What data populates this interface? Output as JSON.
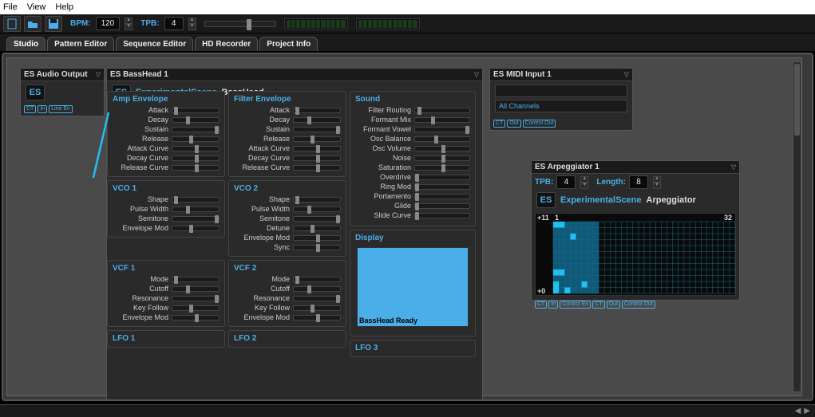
{
  "menu": {
    "file": "File",
    "view": "View",
    "help": "Help"
  },
  "toolbar": {
    "bpm_label": "BPM:",
    "bpm_value": "120",
    "tpb_label": "TPB:",
    "tpb_value": "4"
  },
  "tabs": {
    "studio": "Studio",
    "pattern": "Pattern Editor",
    "sequence": "Sequence Editor",
    "hd": "HD Recorder",
    "project": "Project Info"
  },
  "audio_out": {
    "title": "ES Audio Output",
    "port_ct": "CT",
    "port_in": "In",
    "port_line": "Line En"
  },
  "basshead": {
    "title": "ES BassHead 1",
    "brand": "ExperimentalScene",
    "product": "BassHead",
    "logo": "ES",
    "panels": {
      "amp_env": {
        "title": "Amp Envelope",
        "params": [
          "Attack",
          "Decay",
          "Sustain",
          "Release",
          "Attack Curve",
          "Decay Curve",
          "Release Curve"
        ]
      },
      "filter_env": {
        "title": "Filter Envelope",
        "params": [
          "Attack",
          "Decay",
          "Sustain",
          "Release",
          "Attack Curve",
          "Decay Curve",
          "Release Curve"
        ]
      },
      "sound": {
        "title": "Sound",
        "params": [
          "Filter Routing",
          "Formant Mix",
          "Formant Vowel",
          "Osc Balance",
          "Osc Volume",
          "Noise",
          "Saturation",
          "Overdrive",
          "Ring Mod",
          "Portamento",
          "Glide",
          "Slide Curve"
        ]
      },
      "vco1": {
        "title": "VCO 1",
        "params": [
          "Shape",
          "Pulse Width",
          "Semitone",
          "Envelope Mod"
        ]
      },
      "vco2": {
        "title": "VCO 2",
        "params": [
          "Shape",
          "Pulse Width",
          "Semitone",
          "Detune",
          "Envelope Mod",
          "Sync"
        ]
      },
      "vcf1": {
        "title": "VCF 1",
        "params": [
          "Mode",
          "Cutoff",
          "Resonance",
          "Key Follow",
          "Envelope Mod"
        ]
      },
      "vcf2": {
        "title": "VCF 2",
        "params": [
          "Mode",
          "Cutoff",
          "Resonance",
          "Key Follow",
          "Envelope Mod"
        ]
      },
      "lfo1": {
        "title": "LFO 1"
      },
      "lfo2": {
        "title": "LFO 2"
      },
      "lfo3": {
        "title": "LFO 3"
      },
      "display": {
        "title": "Display",
        "status": "BassHead Ready"
      }
    }
  },
  "midi_in": {
    "title": "ES MIDI Input 1",
    "channel": "All Channels",
    "port_ct": "CT",
    "port_out": "Out",
    "port_ctrlout": "Control Out"
  },
  "arp": {
    "title": "ES Arpeggiator 1",
    "tpb_label": "TPB:",
    "tpb_value": "4",
    "len_label": "Length:",
    "len_value": "8",
    "brand": "ExperimentalScene",
    "product": "Arpeggiator",
    "logo": "ES",
    "y_top": "+11",
    "y_bot": "+0",
    "x_left": "1",
    "x_right": "32",
    "port_ct": "CT",
    "port_in": "In",
    "port_ctrlin": "Control En",
    "port_out": "Out",
    "port_ctrlout": "Control Out",
    "chart_data": {
      "type": "heatmap",
      "x_range": [
        1,
        32
      ],
      "y_range": [
        0,
        11
      ],
      "active_cols": 8,
      "cells_on": [
        {
          "col": 1,
          "row": 11
        },
        {
          "col": 2,
          "row": 11
        },
        {
          "col": 4,
          "row": 9
        },
        {
          "col": 1,
          "row": 3
        },
        {
          "col": 2,
          "row": 3
        },
        {
          "col": 1,
          "row": 1
        },
        {
          "col": 6,
          "row": 1
        },
        {
          "col": 1,
          "row": 0
        },
        {
          "col": 3,
          "row": 0
        }
      ]
    }
  }
}
